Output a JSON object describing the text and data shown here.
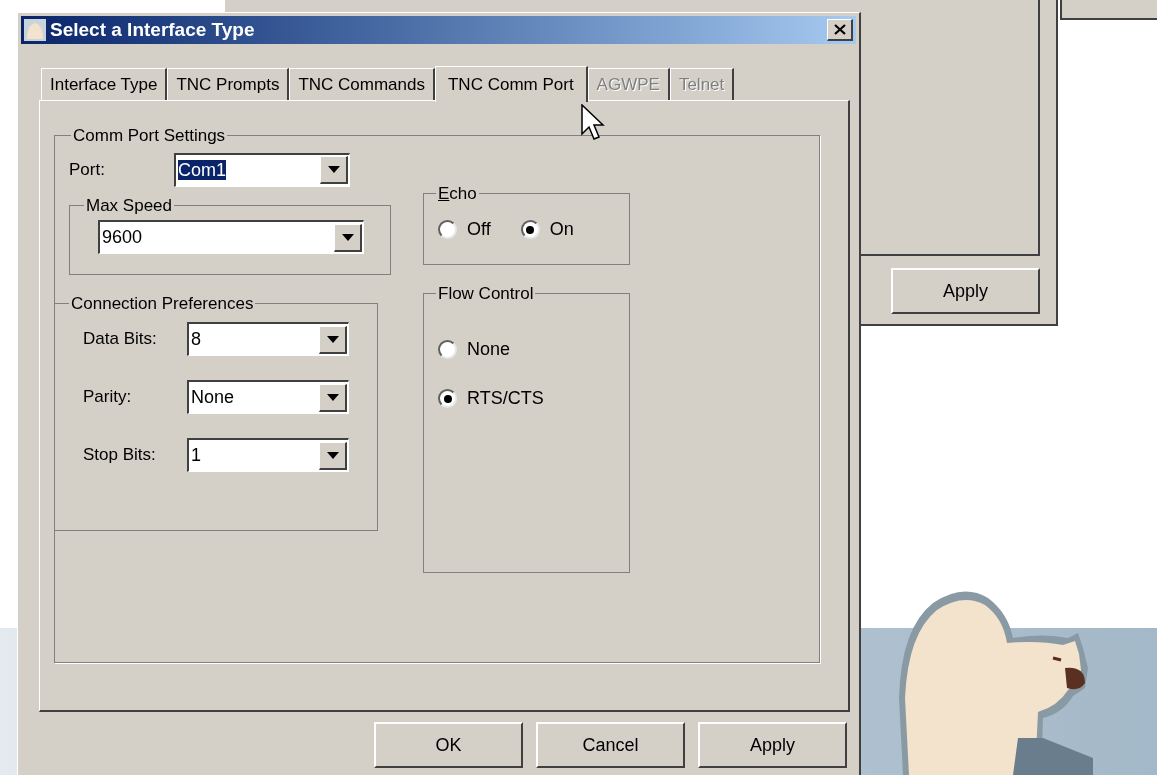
{
  "background_window": {
    "buttons": [
      "Apply"
    ]
  },
  "dialog": {
    "title": "Select a Interface Type",
    "tabs": [
      {
        "label": "Interface Type",
        "selected": false,
        "disabled": false
      },
      {
        "label": "TNC Prompts",
        "selected": false,
        "disabled": false
      },
      {
        "label": "TNC Commands",
        "selected": false,
        "disabled": false
      },
      {
        "label": "TNC Comm Port",
        "selected": true,
        "disabled": false
      },
      {
        "label": "AGWPE",
        "selected": false,
        "disabled": true
      },
      {
        "label": "Telnet",
        "selected": false,
        "disabled": true
      }
    ],
    "comm_port_settings": {
      "title": "Comm Port Settings",
      "port": {
        "label": "Port:",
        "value": "Com1",
        "selected": true
      },
      "max_speed": {
        "title": "Max Speed",
        "value": "9600"
      }
    },
    "connection_preferences": {
      "title": "Connection Preferences",
      "fields": [
        {
          "label": "Data Bits:",
          "value": "8"
        },
        {
          "label": "Parity:",
          "value": "None"
        },
        {
          "label": "Stop Bits:",
          "value": "1"
        }
      ]
    },
    "echo": {
      "title": "Echo",
      "access_key_underlined": true,
      "options": [
        {
          "label": "Off",
          "selected": false
        },
        {
          "label": "On",
          "selected": true
        }
      ]
    },
    "flow_control": {
      "title": "Flow Control",
      "options": [
        {
          "label": "None",
          "selected": false
        },
        {
          "label": "RTS/CTS",
          "selected": true
        }
      ]
    },
    "buttons": [
      "OK",
      "Cancel",
      "Apply"
    ]
  }
}
